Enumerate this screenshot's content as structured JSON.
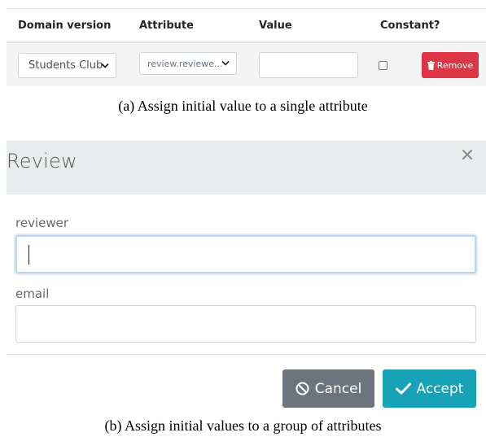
{
  "panel_a": {
    "headers": [
      "Domain version",
      "Attribute",
      "Value",
      "Constant?"
    ],
    "row": {
      "domain_version": "Students Club",
      "attribute": "review.reviewe...",
      "value": "",
      "constant": false,
      "remove_label": "Remove"
    },
    "caption": "(a) Assign initial value to a single attribute"
  },
  "panel_b": {
    "title": "Review",
    "fields": [
      {
        "label": "reviewer",
        "value": ""
      },
      {
        "label": "email",
        "value": ""
      }
    ],
    "cancel_label": "Cancel",
    "accept_label": "Accept",
    "caption": "(b) Assign initial values to a group of attributes"
  },
  "colors": {
    "remove": "#dc3545",
    "cancel": "#6c757d",
    "accept": "#17a2b8",
    "modal_header": "#e9ecec"
  },
  "icons": [
    "chevron-down-icon",
    "trash-icon",
    "close-icon",
    "ban-icon",
    "check-icon"
  ]
}
